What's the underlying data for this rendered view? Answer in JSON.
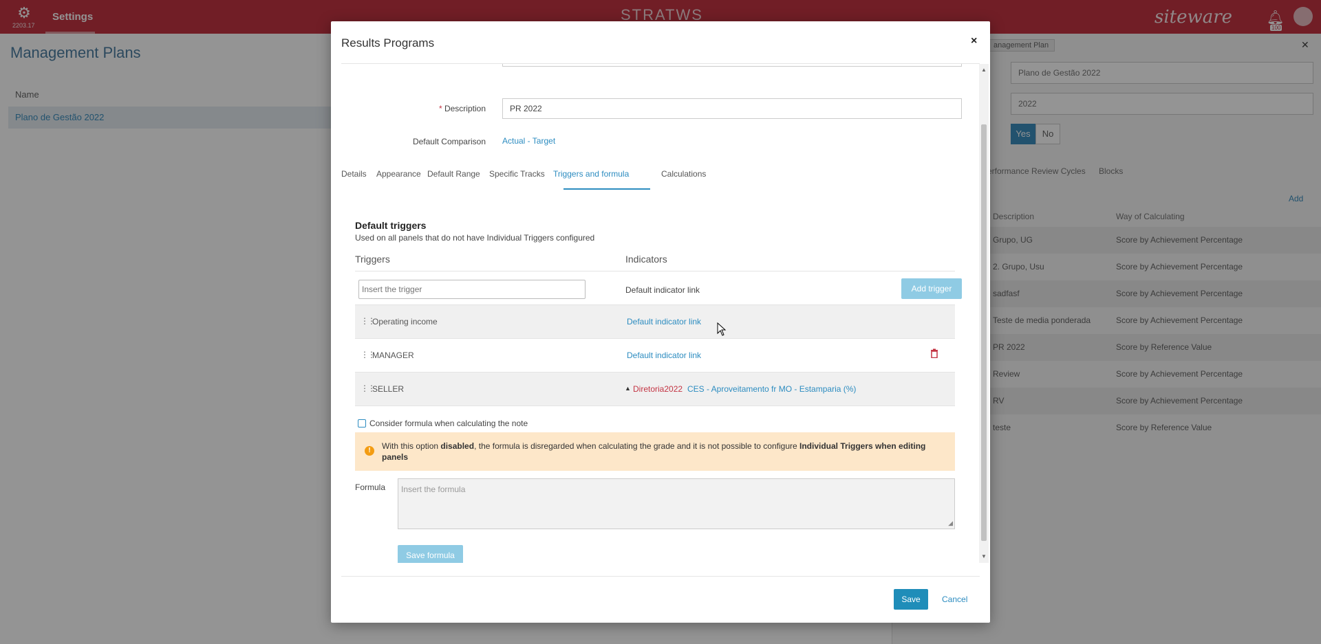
{
  "topbar": {
    "version": "2203.17",
    "section": "Settings",
    "product": "STRATWS",
    "brand": "siteware",
    "notification_badge": "100"
  },
  "background": {
    "page_title": "Management Plans",
    "table_header": "Name",
    "rows": [
      "Plano de Gestão 2022"
    ]
  },
  "right_panel": {
    "title": "anagement Plan",
    "name_value": "Plano de Gestão 2022",
    "year_value": "2022",
    "yes_label": "Yes",
    "no_label": "No",
    "tabs": [
      "erformance Review Cycles",
      "Blocks"
    ],
    "add_label": "Add",
    "col_description": "Description",
    "col_way": "Way of Calculating",
    "rows": [
      {
        "description": "Grupo, UG",
        "way": "Score by Achievement Percentage"
      },
      {
        "description": "2. Grupo, Usu",
        "way": "Score by Achievement Percentage"
      },
      {
        "description": "sadfasf",
        "way": "Score by Achievement Percentage"
      },
      {
        "description": "Teste de media ponderada",
        "way": "Score by Achievement Percentage"
      },
      {
        "description": "PR 2022",
        "way": "Score by Reference Value"
      },
      {
        "description": "Review",
        "way": "Score by Achievement Percentage"
      },
      {
        "description": "RV",
        "way": "Score by Achievement Percentage"
      },
      {
        "description": "teste",
        "way": "Score by Reference Value"
      }
    ]
  },
  "modal": {
    "title": "Results Programs",
    "close_icon": "×",
    "description_label": "Description",
    "description_value": "PR 2022",
    "comparison_label": "Default Comparison",
    "comparison_value": "Actual - Target",
    "tabs": [
      "Details",
      "Appearance",
      "Default Range",
      "Specific Tracks",
      "Triggers and formula",
      "Calculations"
    ],
    "active_tab": "Triggers and formula",
    "section_title": "Default triggers",
    "section_subtitle": "Used on all panels that do not have Individual Triggers configured",
    "col_triggers": "Triggers",
    "col_indicators": "Indicators",
    "trigger_placeholder": "Insert the trigger",
    "new_row_indicator": "Default indicator link",
    "add_trigger_label": "Add trigger",
    "triggers": [
      {
        "name": "Operating income",
        "indicator": "Default indicator link"
      },
      {
        "name": "MANAGER",
        "indicator": "Default indicator link"
      },
      {
        "name": "SELLER",
        "indicator_org": "Diretoria2022",
        "indicator_name": "CES - Aproveitamento fr MO - Estamparia (%)"
      }
    ],
    "checkbox_label": "Consider formula when calculating the note",
    "warning": {
      "text_1": "With this option ",
      "bold_1": "disabled",
      "text_2": ", the formula is disregarded when calculating the grade and it is not possible to configure ",
      "bold_2": "Individual Triggers when editing panels"
    },
    "formula_label": "Formula",
    "formula_placeholder": "Insert the formula",
    "save_formula_label": "Save formula",
    "save_label": "Save",
    "cancel_label": "Cancel"
  },
  "icons": {
    "settings": "gear-icon",
    "notifications": "bell-icon",
    "drag": "drag-handle-icon",
    "delete": "trash-icon",
    "warning": "warning-icon"
  },
  "colors": {
    "topbar": "#c33443",
    "accent": "#2c8cc0",
    "button_disabled": "#8fcbe4",
    "warning_bg": "#fde7c9",
    "danger": "#c33443"
  }
}
